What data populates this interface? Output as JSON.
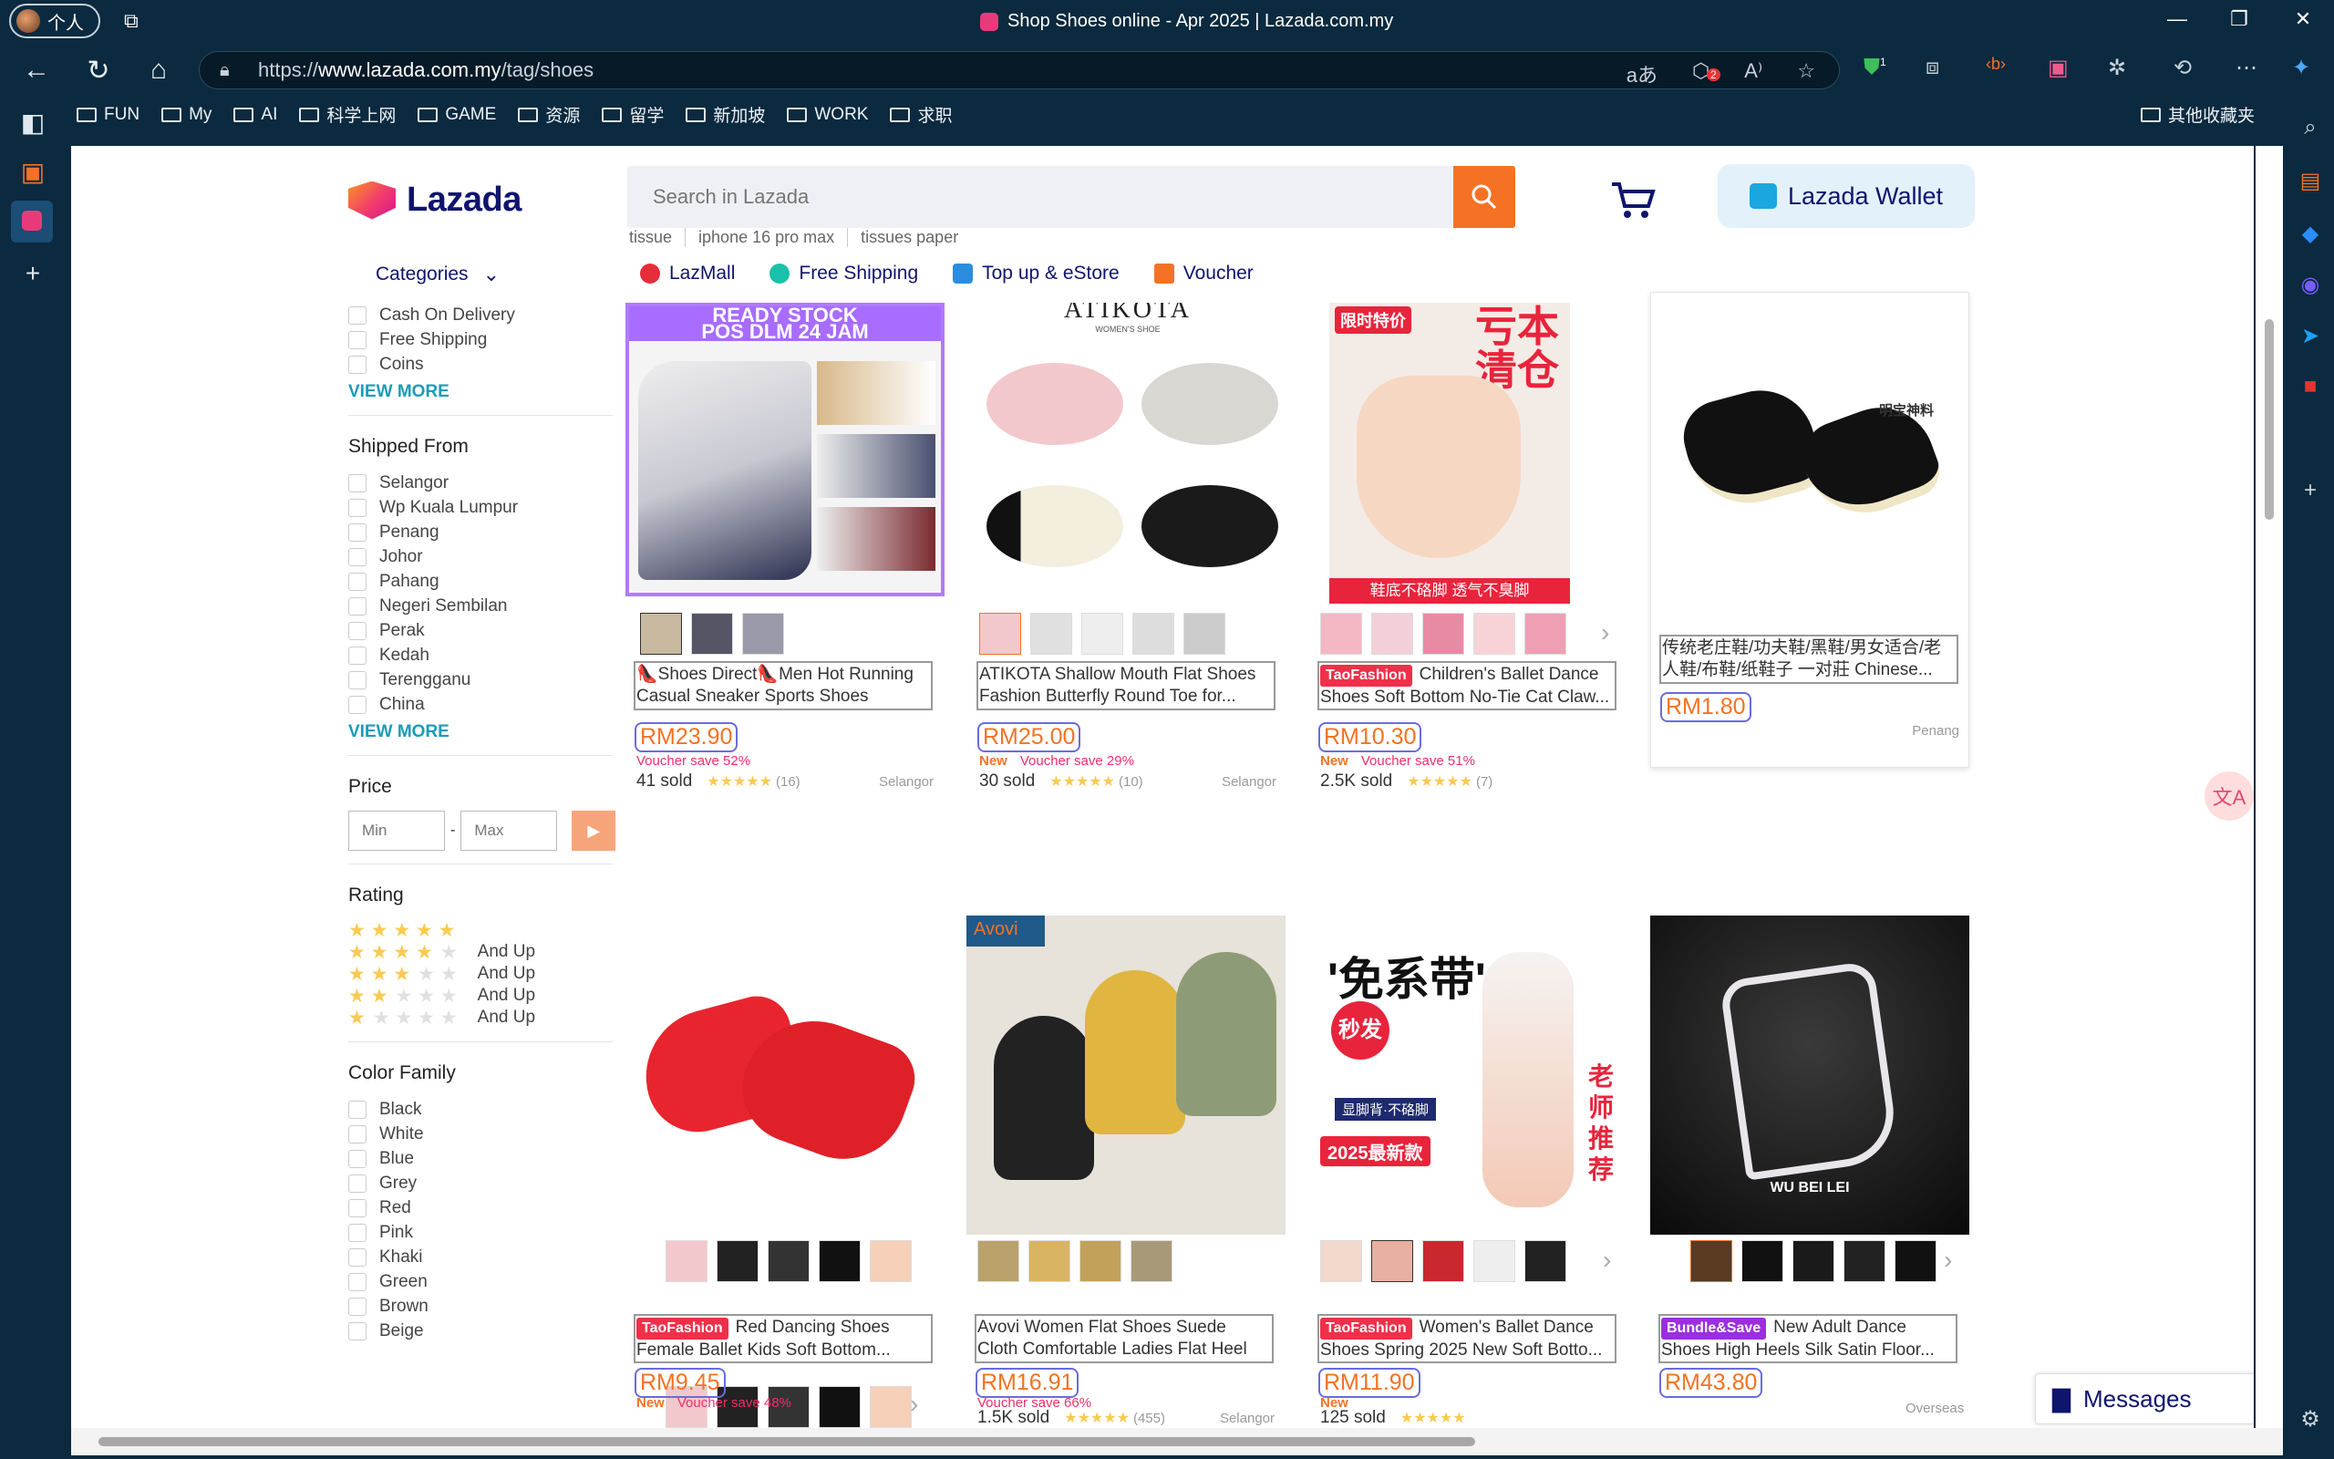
{
  "browser": {
    "profile": "个人",
    "window_title": "Shop Shoes online - Apr 2025 | Lazada.com.my",
    "url_prefix": "https://",
    "url_domain": "www.lazada.com.my",
    "url_path": "/tag/shoes",
    "badge_a": "2",
    "badge_b": "1"
  },
  "bookmarks": [
    "FUN",
    "My",
    "AI",
    "科学上网",
    "GAME",
    "资源",
    "留学",
    "新加坡",
    "WORK",
    "求职"
  ],
  "other_bookmarks": "其他收藏夹",
  "header": {
    "logo": "Lazada",
    "search_placeholder": "Search in Lazada",
    "wallet": "Lazada Wallet",
    "suggestions": [
      "tissue",
      "iphone 16 pro max",
      "tissues paper"
    ],
    "categories": "Categories",
    "nav": [
      "LazMall",
      "Free Shipping",
      "Top up & eStore",
      "Voucher"
    ]
  },
  "filters": {
    "services": [
      "Cash On Delivery",
      "Free Shipping",
      "Coins"
    ],
    "view_more": "VIEW MORE",
    "shipped_from_title": "Shipped From",
    "shipped_from": [
      "Selangor",
      "Wp Kuala Lumpur",
      "Penang",
      "Johor",
      "Pahang",
      "Negeri Sembilan",
      "Perak",
      "Kedah",
      "Terengganu",
      "China"
    ],
    "price_title": "Price",
    "min": "Min",
    "max": "Max",
    "sep": "-",
    "rating_title": "Rating",
    "and_up": "And Up",
    "color_title": "Color Family",
    "colors": [
      "Black",
      "White",
      "Blue",
      "Grey",
      "Red",
      "Pink",
      "Khaki",
      "Green",
      "Brown",
      "Beige"
    ]
  },
  "products": [
    {
      "title": "👠Shoes Direct👠Men Hot Running Casual Sneaker Sports Shoes",
      "price": "RM23.90",
      "new": "",
      "voucher": "Voucher save 52%",
      "sold": "41 sold",
      "reviews": "(16)",
      "location": "Selangor",
      "tag": ""
    },
    {
      "title": "ATIKOTA Shallow Mouth Flat Shoes Fashion Butterfly Round Toe for...",
      "price": "RM25.00",
      "new": "New",
      "voucher": "Voucher save 29%",
      "sold": "30 sold",
      "reviews": "(10)",
      "location": "Selangor",
      "tag": ""
    },
    {
      "title": "Children's Ballet Dance Shoes Soft Bottom No-Tie Cat Claw...",
      "price": "RM10.30",
      "new": "New",
      "voucher": "Voucher save 51%",
      "sold": "2.5K sold",
      "reviews": "(7)",
      "location": "",
      "tag": "TaoFashion"
    },
    {
      "title": "传统老庄鞋/功夫鞋/黑鞋/男女适合/老人鞋/布鞋/纸鞋子 一对莊 Chinese...",
      "price": "RM1.80",
      "location": "Penang"
    },
    {
      "title": "Red Dancing Shoes Female Ballet Kids Soft Bottom...",
      "price": "RM9.45",
      "new": "New",
      "voucher": "Voucher save 48%",
      "tag": "TaoFashion"
    },
    {
      "title": "Avovi Women Flat Shoes Suede Cloth Comfortable Ladies Flat Heel Work...",
      "price": "RM16.91",
      "voucher": "Voucher save 66%",
      "sold": "1.5K sold",
      "reviews": "(455)",
      "location": "Selangor"
    },
    {
      "title": "Women's Ballet Dance Shoes Spring 2025 New Soft Botto...",
      "price": "RM11.90",
      "new": "New",
      "sold": "125 sold",
      "tag": "TaoFashion"
    },
    {
      "title": "New Adult Dance Shoes High Heels Silk Satin Floor...",
      "price": "RM43.80",
      "location": "Overseas",
      "tag": "Bundle&Save"
    }
  ],
  "image_text": {
    "p1_banner": "READY STOCK",
    "p1_banner2": "POS DLM 24 JAM",
    "p2_brand": "ATIKOTA",
    "p2_sub": "WOMEN'S SHOE",
    "p3_badge": "限时特价",
    "p3_big1": "亏本",
    "p3_big2": "清仓",
    "p3_bottom": "鞋底不硌脚 透气不臭脚",
    "p4_label": "明宝神料",
    "p6_brand": "Avovi",
    "p7_big": "'免系带'",
    "p7_mid": "秒发",
    "p7_sub": "显脚背·不硌脚",
    "p7_year": "2025最新款",
    "p7_side": "老师推荐",
    "p8_brand": "WU BEI LEI"
  },
  "messages": "Messages",
  "colors": {
    "accent": "#f57224",
    "brand": "#0f146d",
    "link": "#1a9cb7",
    "voucher": "#f02d6b",
    "taofashion": "#f0304a",
    "bundle": "#9b2ee0"
  }
}
